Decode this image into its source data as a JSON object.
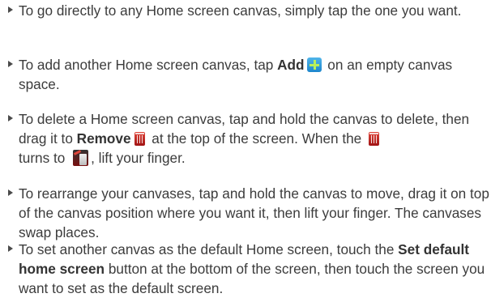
{
  "items": [
    {
      "before": "To go directly to any Home screen canvas, simply tap the one you want."
    },
    {
      "before": "To add another Home screen canvas, tap ",
      "bold1": "Add",
      "icon": "add-icon",
      "after": " on an empty canvas space."
    },
    {
      "before": "To delete a Home screen canvas, tap and hold the canvas to delete, then drag it to ",
      "bold1": "Remove",
      "icon1": "trash-icon",
      "mid": " at the top of the screen. When the ",
      "icon2": "trash-icon",
      "mid2": " turns to ",
      "icon3": "trash-open-icon",
      "after": ", lift your finger."
    },
    {
      "before": "To rearrange your canvases, tap and hold the canvas to move, drag it on top of the canvas position where you want it, then lift your finger. The canvases swap places."
    },
    {
      "before": "To set another canvas as the default Home screen, touch the ",
      "bold1": "Set default home screen",
      "after": " button at the bottom of the screen, then touch the screen you want to set as the default screen."
    }
  ],
  "colors": {
    "text": "#3c3c3c",
    "bullet": "#4a4a4a",
    "add_icon": "#1e86cc",
    "trash_icon": "#c0261e"
  }
}
